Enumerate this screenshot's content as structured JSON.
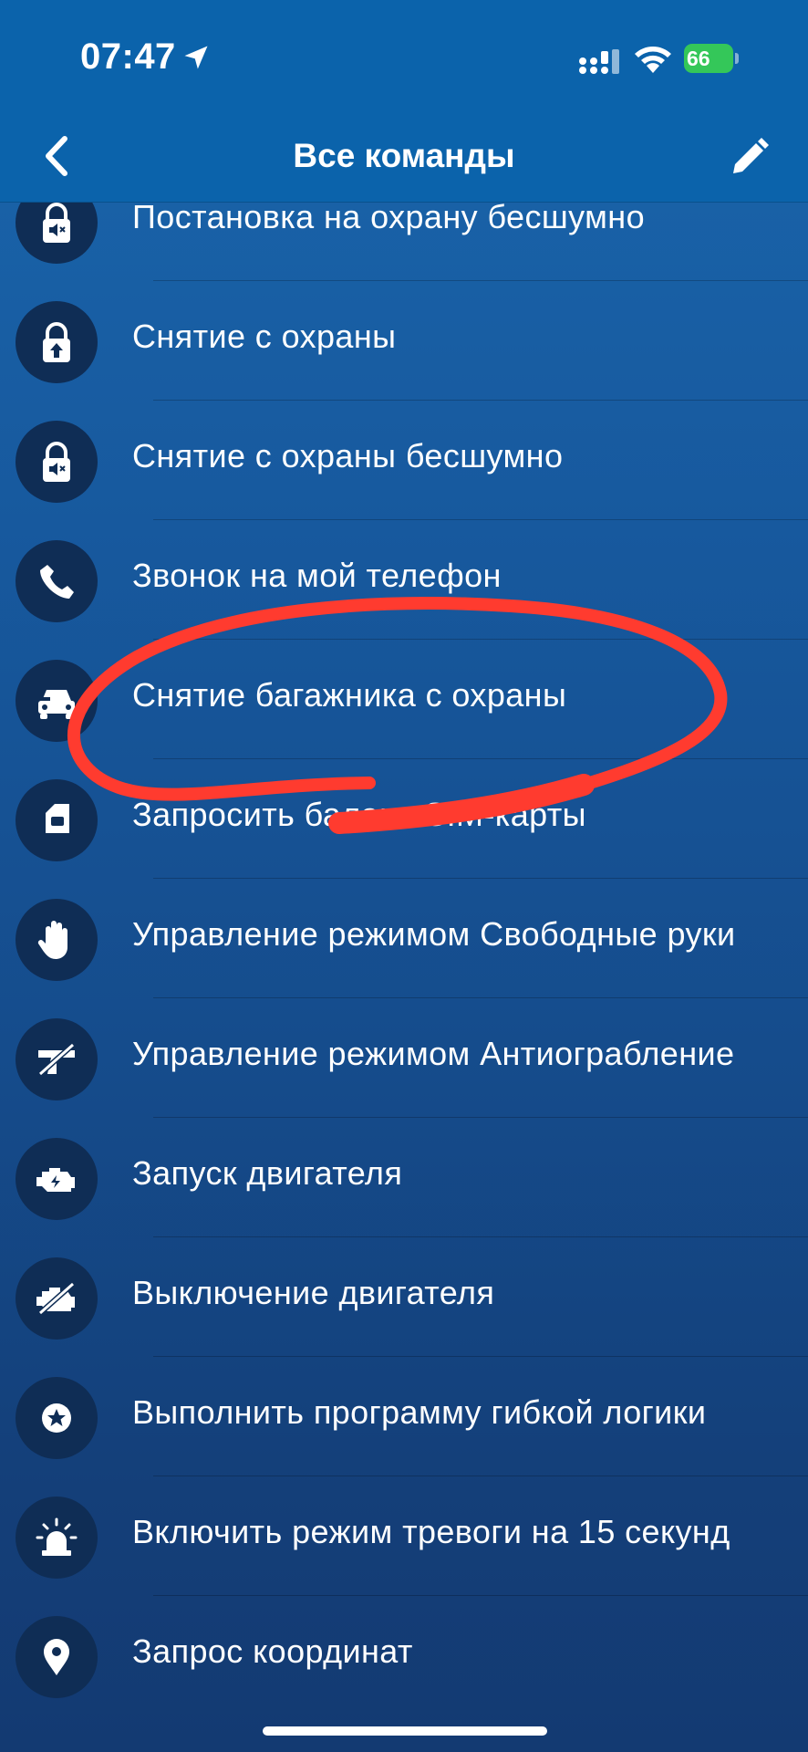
{
  "status_bar": {
    "time": "07:47",
    "battery": "66",
    "icons": [
      "location-arrow-icon",
      "signal-icon",
      "wifi-icon",
      "battery-charging-icon"
    ]
  },
  "nav": {
    "title": "Все команды",
    "back_icon": "chevron-left-icon",
    "edit_icon": "pencil-icon"
  },
  "commands": [
    {
      "label": "Постановка на охрану бесшумно",
      "icon": "lock-muted-icon"
    },
    {
      "label": "Снятие с охраны",
      "icon": "unlock-icon"
    },
    {
      "label": "Снятие с охраны бесшумно",
      "icon": "lock-muted-icon"
    },
    {
      "label": "Звонок на мой телефон",
      "icon": "phone-icon"
    },
    {
      "label": "Снятие багажника с охраны",
      "icon": "car-trunk-icon"
    },
    {
      "label": "Запросить баланс SIM-карты",
      "icon": "sim-card-icon"
    },
    {
      "label": "Управление режимом Свободные руки",
      "icon": "hand-icon"
    },
    {
      "label": "Управление режимом Антиограбление",
      "icon": "gun-crossed-icon"
    },
    {
      "label": "Запуск двигателя",
      "icon": "engine-start-icon"
    },
    {
      "label": "Выключение двигателя",
      "icon": "engine-off-icon"
    },
    {
      "label": "Выполнить программу гибкой логики",
      "icon": "star-badge-icon"
    },
    {
      "label": "Включить режим тревоги на 15 секунд",
      "icon": "siren-icon"
    },
    {
      "label": "Запрос координат",
      "icon": "map-pin-icon"
    }
  ],
  "colors": {
    "header": "#0b63ab",
    "icon_circle": "#0f2d55",
    "annotation_stroke": "#ff3b2f",
    "battery": "#34c759"
  }
}
